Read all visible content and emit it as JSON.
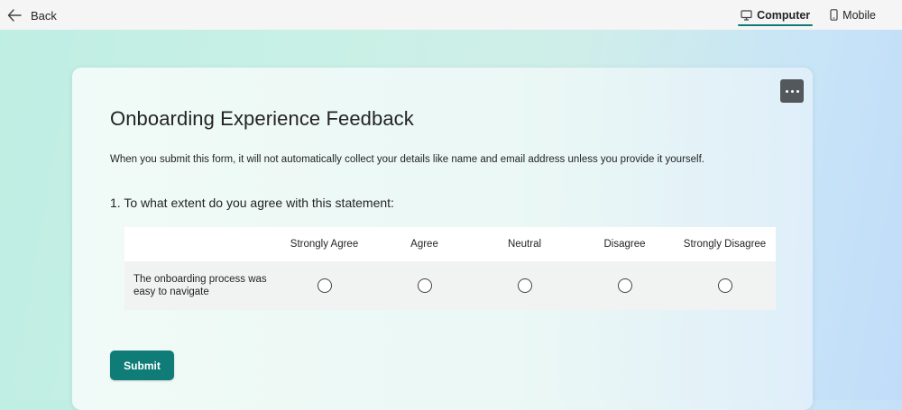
{
  "topbar": {
    "back_label": "Back",
    "tabs": [
      {
        "label": "Computer",
        "icon": "monitor-icon",
        "active": true
      },
      {
        "label": "Mobile",
        "icon": "phone-icon",
        "active": false
      }
    ]
  },
  "form": {
    "title": "Onboarding Experience Feedback",
    "description": "When you submit this form, it will not automatically collect your details like name and email address unless you provide it yourself.",
    "more_button_icon": "more-horizontal-icon",
    "questions": [
      {
        "number": "1.",
        "text": "To what extent do you agree with this statement:",
        "full_text": "1. To what extent do you agree with this statement:",
        "options": [
          "Strongly Agree",
          "Agree",
          "Neutral",
          "Disagree",
          "Strongly Disagree"
        ],
        "statements": [
          {
            "text": "The onboarding process was easy to navigate",
            "selected": null
          }
        ]
      }
    ],
    "submit_label": "Submit"
  },
  "colors": {
    "accent": "#0f7c77",
    "topbar_bg": "#f5f5f5",
    "more_button_bg": "#53585c",
    "text": "#242424"
  }
}
